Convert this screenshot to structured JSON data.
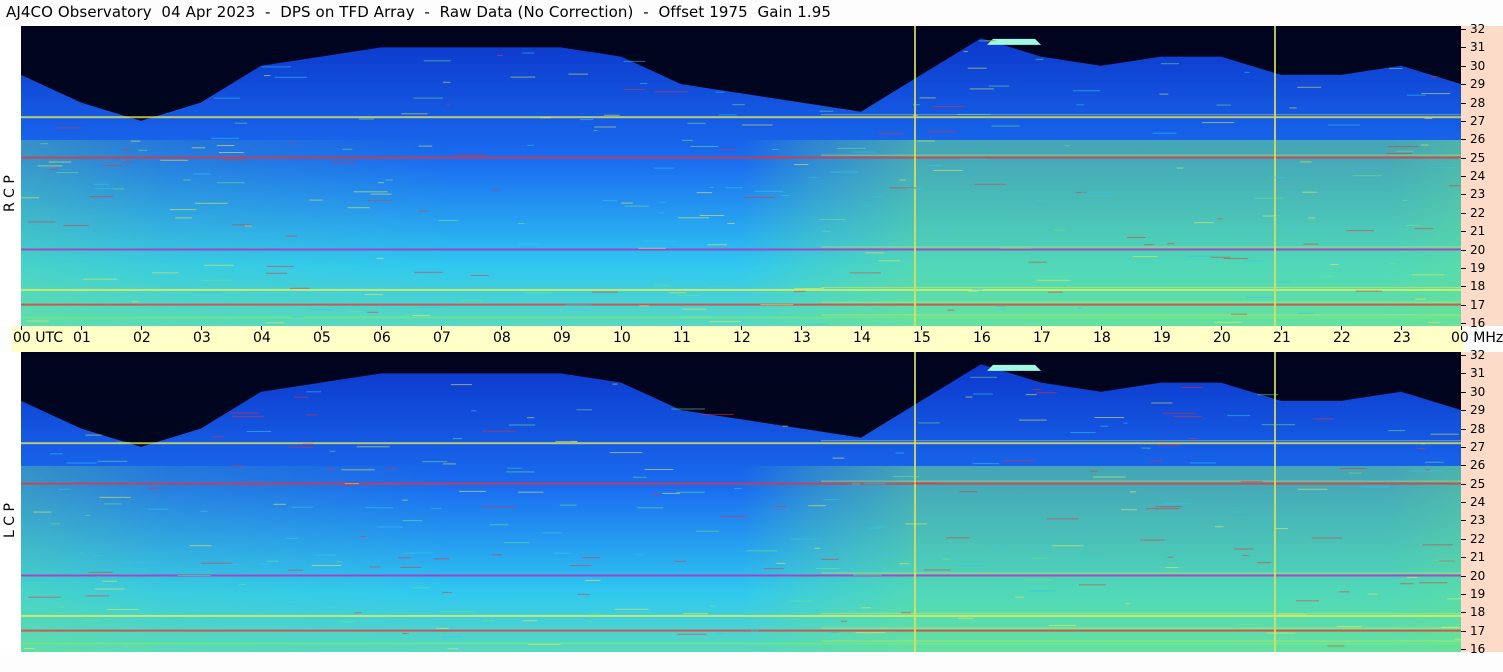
{
  "header": {
    "title": "AJ4CO Observatory  04 Apr 2023  -  DPS on TFD Array  -  Raw Data (No Correction)  -  Offset 1975  Gain 1.95"
  },
  "panels": [
    {
      "id": "rcp",
      "polarization_label": "R C P"
    },
    {
      "id": "lcp",
      "polarization_label": "L C P"
    }
  ],
  "time_axis": {
    "labels": [
      "00",
      "01",
      "02",
      "03",
      "04",
      "05",
      "06",
      "07",
      "08",
      "09",
      "10",
      "11",
      "12",
      "13",
      "14",
      "15",
      "16",
      "17",
      "18",
      "19",
      "20",
      "21",
      "22",
      "23",
      "00"
    ],
    "start_label_unit": "UTC",
    "end_label_unit": "MHz"
  },
  "freq_axis": {
    "labels": [
      "32",
      "31",
      "30",
      "29",
      "28",
      "27",
      "26",
      "25",
      "24",
      "23",
      "22",
      "21",
      "20",
      "19",
      "18",
      "17",
      "16"
    ]
  },
  "colors": {
    "background": "#000010",
    "deep_blue": "#0b33c8",
    "mid_blue": "#1a6cf0",
    "cyan": "#30c8f0",
    "green": "#70e880",
    "yellow": "#f0f050",
    "red": "#f03030",
    "magenta": "#c020c0",
    "time_axis_bg": "#ffffc8",
    "freq_axis_bg": "#fcdcc8"
  },
  "chart_data": {
    "type": "heatmap",
    "title": "AJ4CO Observatory  04 Apr 2023  -  DPS on TFD Array  -  Raw Data (No Correction)  -  Offset 1975  Gain 1.95",
    "x_unit": "UTC",
    "x_range": [
      0,
      24
    ],
    "y_unit": "MHz",
    "y_range": [
      16,
      32
    ],
    "series": [
      {
        "name": "R C P"
      },
      {
        "name": "L C P"
      }
    ],
    "features": {
      "dark_region_above_mhz_by_hour": [
        [
          0,
          29.5
        ],
        [
          1,
          28
        ],
        [
          2,
          27
        ],
        [
          3,
          28
        ],
        [
          4,
          30
        ],
        [
          5,
          30.5
        ],
        [
          6,
          31
        ],
        [
          7,
          31
        ],
        [
          8,
          31
        ],
        [
          9,
          31
        ],
        [
          10,
          30.5
        ],
        [
          11,
          29
        ],
        [
          12,
          28.5
        ],
        [
          13,
          28
        ],
        [
          14,
          27.5
        ],
        [
          15,
          29.5
        ],
        [
          16,
          31.5
        ],
        [
          17,
          30.5
        ],
        [
          18,
          30
        ],
        [
          19,
          30.5
        ],
        [
          20,
          30.5
        ],
        [
          21,
          29.5
        ],
        [
          22,
          29.5
        ],
        [
          23,
          30
        ],
        [
          24,
          29
        ]
      ],
      "vertical_lines_hours": [
        14.9,
        20.9
      ],
      "horizontal_bands_mhz": [
        27.2,
        25.0,
        20.0,
        17.8,
        17.0,
        16.3
      ],
      "burst": {
        "hour_start": 16.1,
        "hour_end": 17.0,
        "mhz": 31.3
      }
    }
  }
}
